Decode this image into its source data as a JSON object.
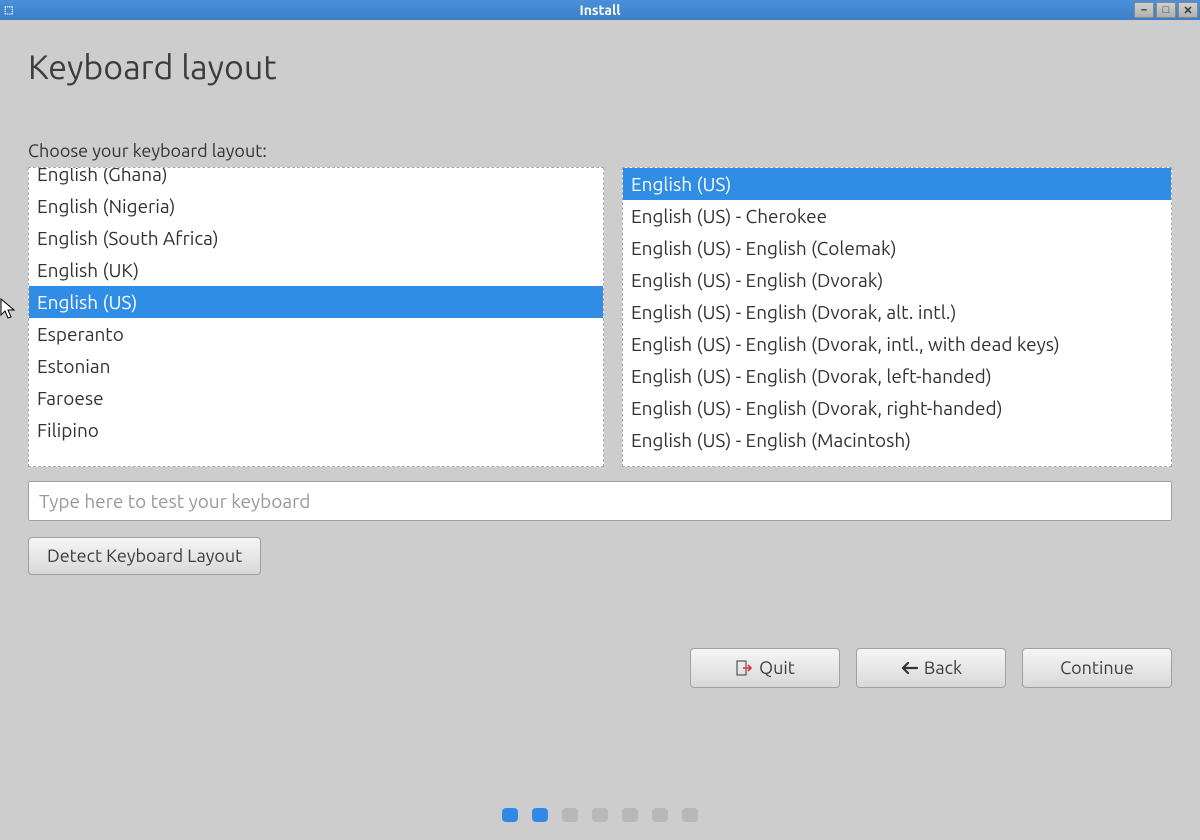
{
  "window": {
    "title": "Install"
  },
  "page": {
    "title": "Keyboard layout",
    "choose_label": "Choose your keyboard layout:"
  },
  "layouts": {
    "left": [
      {
        "label": "English (Ghana)",
        "selected": false
      },
      {
        "label": "English (Nigeria)",
        "selected": false
      },
      {
        "label": "English (South Africa)",
        "selected": false
      },
      {
        "label": "English (UK)",
        "selected": false
      },
      {
        "label": "English (US)",
        "selected": true
      },
      {
        "label": "Esperanto",
        "selected": false
      },
      {
        "label": "Estonian",
        "selected": false
      },
      {
        "label": "Faroese",
        "selected": false
      },
      {
        "label": "Filipino",
        "selected": false
      }
    ],
    "right": [
      {
        "label": "English (US)",
        "selected": true
      },
      {
        "label": "English (US) - Cherokee",
        "selected": false
      },
      {
        "label": "English (US) - English (Colemak)",
        "selected": false
      },
      {
        "label": "English (US) - English (Dvorak)",
        "selected": false
      },
      {
        "label": "English (US) - English (Dvorak, alt. intl.)",
        "selected": false
      },
      {
        "label": "English (US) - English (Dvorak, intl., with dead keys)",
        "selected": false
      },
      {
        "label": "English (US) - English (Dvorak, left-handed)",
        "selected": false
      },
      {
        "label": "English (US) - English (Dvorak, right-handed)",
        "selected": false
      },
      {
        "label": "English (US) - English (Macintosh)",
        "selected": false
      }
    ]
  },
  "test_input": {
    "placeholder": "Type here to test your keyboard",
    "value": ""
  },
  "buttons": {
    "detect": "Detect Keyboard Layout",
    "quit": "Quit",
    "back": "Back",
    "continue": "Continue"
  },
  "progress": {
    "total": 7,
    "active": [
      0,
      1
    ]
  }
}
